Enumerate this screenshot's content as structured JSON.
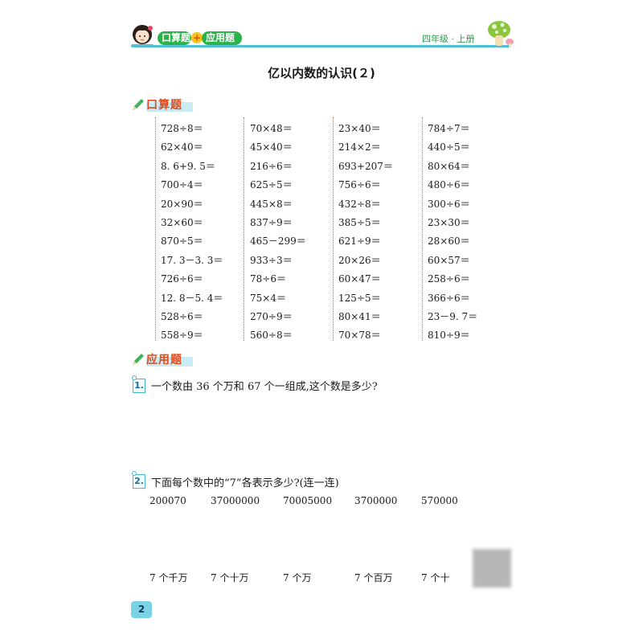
{
  "header": {
    "tag_oral": "口算题",
    "plus": "+",
    "tag_applied": "应用题",
    "grade": "四年级 · 上册"
  },
  "title": "亿以内数的认识(２)",
  "oral": {
    "heading": "口算题",
    "columns": [
      [
        "728÷8＝",
        "62×40＝",
        "8. 6+9. 5＝",
        "700÷4＝",
        "20×90＝",
        "32×60＝",
        "870÷5＝",
        "17. 3－3. 3＝",
        "726÷6＝",
        "12. 8－5. 4＝",
        "528÷6＝",
        "558÷9＝"
      ],
      [
        "70×48＝",
        "45×40＝",
        "216÷6＝",
        "625÷5＝",
        "445×8＝",
        "837÷9＝",
        "465－299＝",
        "933÷3＝",
        "78÷6＝",
        "75×4＝",
        "270÷9＝",
        "560÷8＝"
      ],
      [
        "23×40＝",
        "214×2＝",
        "693+207＝",
        "756÷6＝",
        "432÷8＝",
        "385÷5＝",
        "621÷9＝",
        "20×26＝",
        "60×47＝",
        "125÷5＝",
        "80×41＝",
        "70×78＝"
      ],
      [
        "784÷7＝",
        "440÷5＝",
        "80×64＝",
        "480÷6＝",
        "300÷6＝",
        "23×30＝",
        "28×60＝",
        "60×57＝",
        "258÷6＝",
        "366÷6＝",
        "23－9. 7＝",
        "810÷9＝"
      ]
    ]
  },
  "applied": {
    "heading": "应用题",
    "q1": {
      "num": "1.",
      "text": "一个数由 36 个万和 67 个一组成,这个数是多少?"
    },
    "q2": {
      "num": "2.",
      "text": "下面每个数中的“7”各表示多少?(连一连)",
      "numbers": [
        "200070",
        "37000000",
        "70005000",
        "3700000",
        "570000"
      ],
      "places": [
        "7 个千万",
        "7 个十万",
        "7 个万",
        "7 个百万",
        "7 个十"
      ]
    }
  },
  "page_number": "2",
  "colors": {
    "accent": "#4ec0d8",
    "heading": "#e2491b",
    "tag": "#2bb34a",
    "grid_dots": "#e76e4a"
  }
}
